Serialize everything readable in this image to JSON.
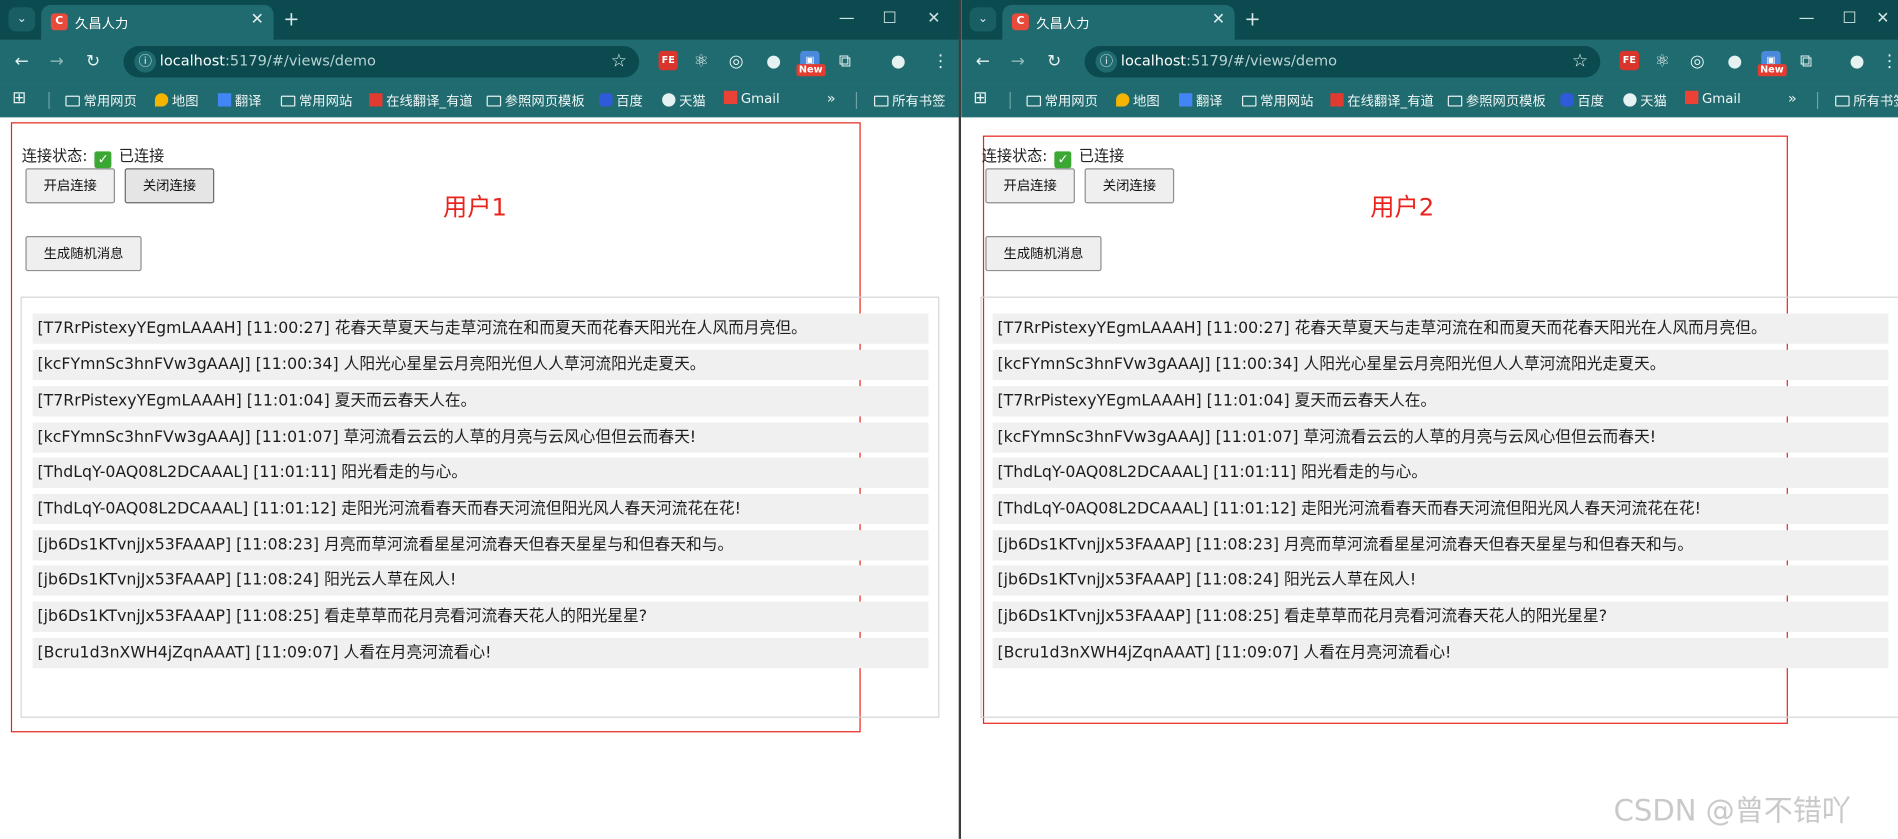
{
  "browser": {
    "tab_title": "久昌人力",
    "favicon_letter": "C",
    "url_host": "localhost",
    "url_rest": ":5179/#/views/demo",
    "new_badge": "New",
    "ext_fe": "FE",
    "icons": {
      "tab_list": "chevron-down-icon",
      "close": "close-icon",
      "new_tab": "plus-icon",
      "back": "arrow-left-icon",
      "forward": "arrow-right-icon",
      "reload": "reload-icon",
      "info": "info-icon",
      "star": "star-icon",
      "profile": "person-icon",
      "menu": "kebab-menu-icon",
      "apps": "apps-grid-icon"
    },
    "bookmarks": [
      {
        "label": "常用网页",
        "icon": "folder-icon"
      },
      {
        "label": "地图",
        "icon": "map-pin-icon"
      },
      {
        "label": "翻译",
        "icon": "translate-icon"
      },
      {
        "label": "常用网站",
        "icon": "folder-icon"
      },
      {
        "label": "在线翻译_有道",
        "icon": "youdao-icon"
      },
      {
        "label": "参照网页模板",
        "icon": "folder-icon"
      },
      {
        "label": "百度",
        "icon": "baidu-icon"
      },
      {
        "label": "天猫",
        "icon": "tmall-icon"
      },
      {
        "label": "Gmail",
        "icon": "gmail-icon"
      }
    ],
    "all_bookmarks": "所有书签"
  },
  "app": {
    "status_label": "连接状态:",
    "status_value": "已连接",
    "open_button": "开启连接",
    "close_button": "关闭连接",
    "generate_button": "生成随机消息",
    "user1_label": "用户1",
    "user2_label": "用户2",
    "messages": [
      "[T7RrPistexyYEgmLAAAH] [11:00:27] 花春天草夏天与走草河流在和而夏天而花春天阳光在人风而月亮但。",
      "[kcFYmnSc3hnFVw3gAAAJ] [11:00:34] 人阳光心星星云月亮阳光但人人草河流阳光走夏天。",
      "[T7RrPistexyYEgmLAAAH] [11:01:04] 夏天而云春天人在。",
      "[kcFYmnSc3hnFVw3gAAAJ] [11:01:07] 草河流看云云的人草的月亮与云风心但但云而春天!",
      "[ThdLqY-0AQ08L2DCAAAL] [11:01:11] 阳光看走的与心。",
      "[ThdLqY-0AQ08L2DCAAAL] [11:01:12] 走阳光河流看春天而春天河流但阳光风人春天河流花在花!",
      "[jb6Ds1KTvnjJx53FAAAP] [11:08:23] 月亮而草河流看星星河流春天但春天星星与和但春天和与。",
      "[jb6Ds1KTvnjJx53FAAAP] [11:08:24] 阳光云人草在风人!",
      "[jb6Ds1KTvnjJx53FAAAP] [11:08:25] 看走草草而花月亮看河流春天花人的阳光星星?",
      "[Bcru1d3nXWH4jZqnAAAT] [11:09:07] 人看在月亮河流看心!"
    ]
  },
  "watermark": "CSDN @曾不错吖"
}
